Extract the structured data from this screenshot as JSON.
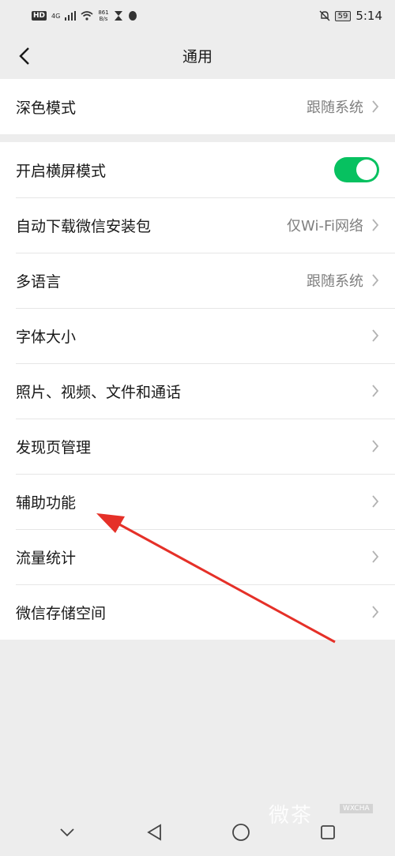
{
  "status_bar": {
    "hd": "HD",
    "signal": "4G",
    "net_speed_value": "861",
    "net_speed_unit": "B/s",
    "battery": "59",
    "time": "5:14"
  },
  "header": {
    "title": "通用"
  },
  "section1": [
    {
      "label": "深色模式",
      "value": "跟随系统"
    }
  ],
  "section2": [
    {
      "label": "开启横屏模式",
      "toggle_on": true
    },
    {
      "label": "自动下载微信安装包",
      "value": "仅Wi-Fi网络"
    },
    {
      "label": "多语言",
      "value": "跟随系统"
    },
    {
      "label": "字体大小"
    },
    {
      "label": "照片、视频、文件和通话"
    },
    {
      "label": "发现页管理"
    },
    {
      "label": "辅助功能"
    },
    {
      "label": "流量统计"
    },
    {
      "label": "微信存储空间"
    }
  ],
  "colors": {
    "accent": "#07c160",
    "annotation_arrow": "#e53028"
  },
  "watermark": {
    "text": "微茶",
    "badge": "WXCHA"
  }
}
